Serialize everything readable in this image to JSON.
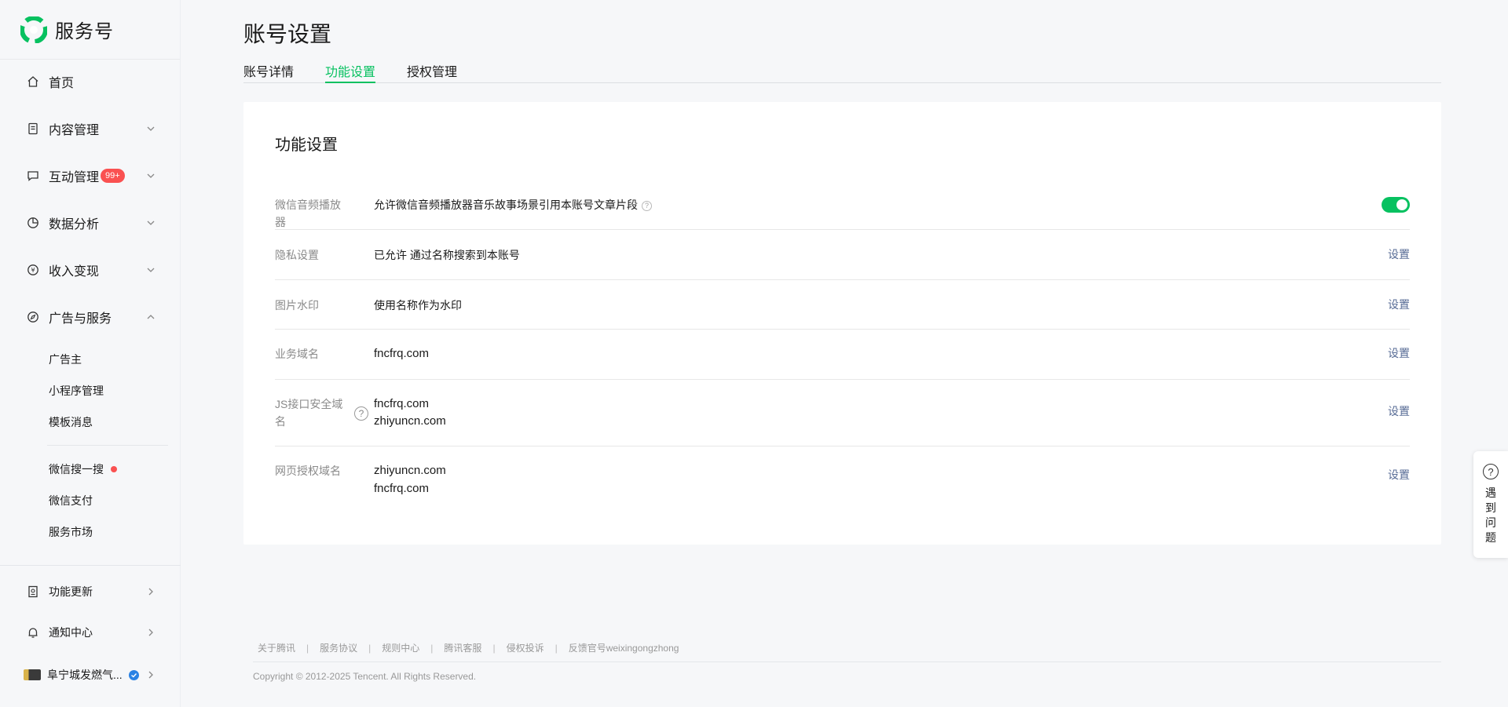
{
  "app": {
    "name": "服务号"
  },
  "sidebar": {
    "items": [
      {
        "label": "首页",
        "icon": "home-icon"
      },
      {
        "label": "内容管理",
        "icon": "document-icon"
      },
      {
        "label": "互动管理",
        "icon": "message-icon",
        "badge": "99+"
      },
      {
        "label": "数据分析",
        "icon": "chart-icon"
      },
      {
        "label": "收入变现",
        "icon": "yuan-icon"
      },
      {
        "label": "广告与服务",
        "icon": "compass-icon"
      }
    ],
    "sub_items": [
      "广告主",
      "小程序管理",
      "模板消息",
      "微信搜一搜",
      "微信支付",
      "服务市场"
    ],
    "bottom": [
      {
        "label": "功能更新",
        "icon": "update-icon"
      },
      {
        "label": "通知中心",
        "icon": "bell-icon"
      },
      {
        "label": "阜宁城发燃气...",
        "icon": "account-avatar"
      }
    ]
  },
  "main": {
    "title": "账号设置",
    "tabs": [
      {
        "label": "账号详情",
        "active": false
      },
      {
        "label": "功能设置",
        "active": true
      },
      {
        "label": "授权管理",
        "active": false
      }
    ],
    "card_title": "功能设置",
    "rows": [
      {
        "label": "微信音频播放器",
        "value": "允许微信音频播放器音乐故事场景引用本账号文章片段",
        "control": "toggle",
        "enabled": true
      },
      {
        "label": "隐私设置",
        "value": "已允许 通过名称搜索到本账号",
        "action": "设置"
      },
      {
        "label": "图片水印",
        "value": "使用名称作为水印",
        "action": "设置"
      },
      {
        "label": "业务域名",
        "value": "fncfrq.com",
        "action": "设置"
      },
      {
        "label": "JS接口安全域名",
        "values": [
          "fncfrq.com",
          "zhiyuncn.com"
        ],
        "action": "设置"
      },
      {
        "label": "网页授权域名",
        "values": [
          "zhiyuncn.com",
          "fncfrq.com"
        ],
        "action": "设置"
      }
    ]
  },
  "footer": {
    "links": [
      "关于腾讯",
      "服务协议",
      "规则中心",
      "腾讯客服",
      "侵权投诉",
      "反馈官号weixingongzhong"
    ],
    "copyright": "Copyright © 2012-2025 Tencent. All Rights Reserved."
  },
  "help": {
    "label": "遇到问题"
  },
  "colors": {
    "accent": "#07c160",
    "link": "#576b95",
    "badge": "#fa5151"
  }
}
